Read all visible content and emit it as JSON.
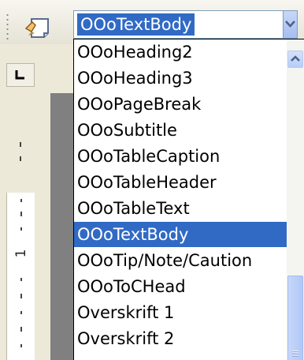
{
  "toolbar": {
    "apply_style_icon": "apply-style-icon",
    "combo_value": "OOoTextBody",
    "combo_button_icon": "chevron-down-icon"
  },
  "style_list": {
    "items": [
      "OOoHeading2",
      "OOoHeading3",
      "OOoPageBreak",
      "OOoSubtitle",
      "OOoTableCaption",
      "OOoTableHeader",
      "OOoTableText",
      "OOoTextBody",
      "OOoTip/Note/Caution",
      "OOoToCHead",
      "Overskrift 1",
      "Overskrift 2"
    ],
    "selected": "OOoTextBody"
  },
  "scrollbar": {
    "up_icon": "chevron-up-icon"
  },
  "ruler": {
    "tab_stop_icon": "left-tab-icon",
    "label": "1"
  },
  "colors": {
    "selection": "#316ac5",
    "toolbar_bg": "#ece9d8",
    "border": "#7f9db9",
    "page_shadow": "#808080"
  }
}
